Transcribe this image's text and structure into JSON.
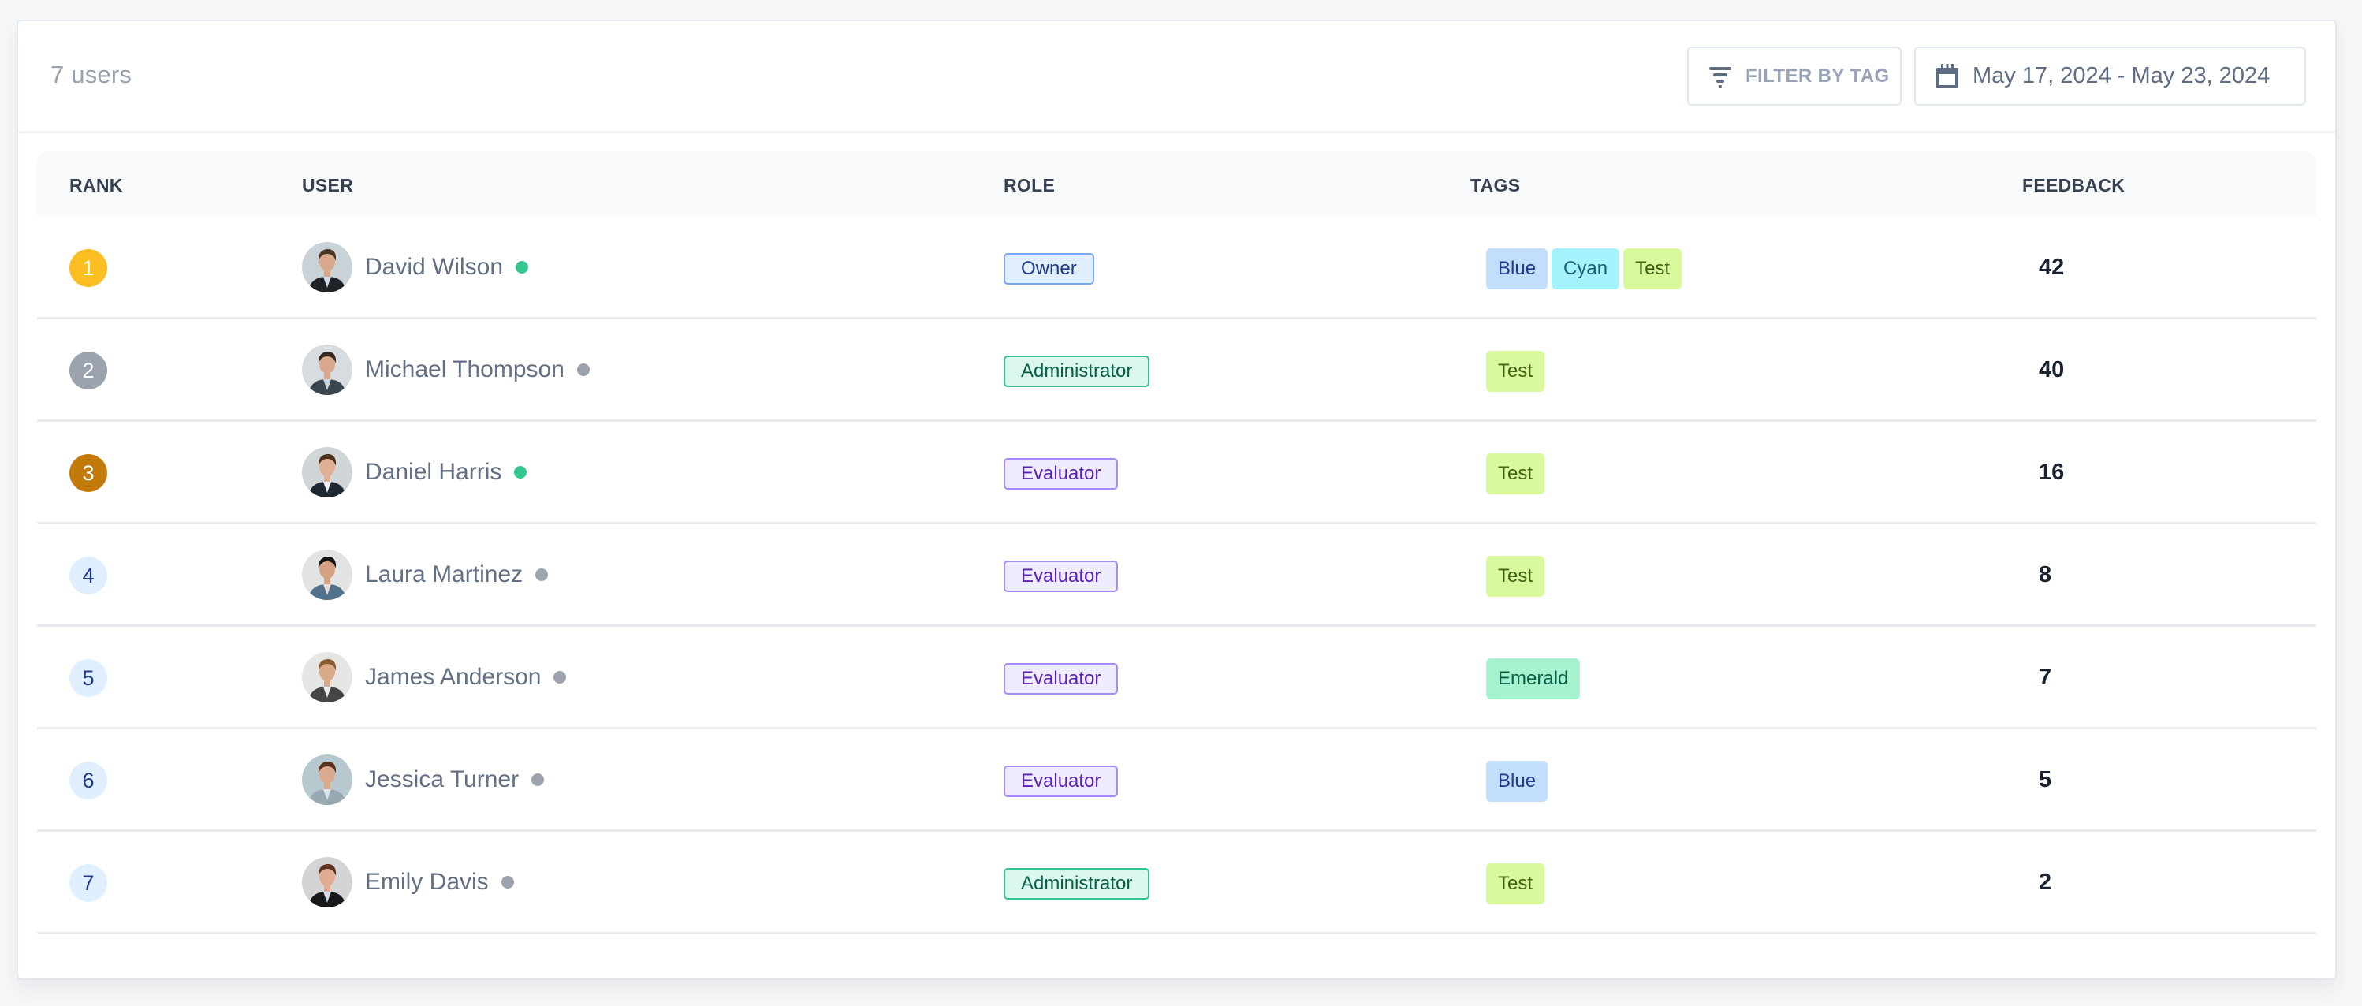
{
  "header": {
    "user_count": "7 users",
    "filter_button": {
      "label": "FILTER BY TAG",
      "icon": "filter-icon"
    },
    "date_range": {
      "label": "May 17, 2024 - May 23, 2024",
      "icon": "calendar-icon"
    }
  },
  "table": {
    "columns": [
      "RANK",
      "USER",
      "ROLE",
      "TAGS",
      "FEEDBACK"
    ],
    "rows": [
      {
        "rank": "1",
        "rank_style": "gold",
        "name": "David Wilson",
        "online": true,
        "role": "Owner",
        "tags": [
          "Blue",
          "Cyan",
          "Test"
        ],
        "feedback": "42"
      },
      {
        "rank": "2",
        "rank_style": "silver",
        "name": "Michael Thompson",
        "online": false,
        "role": "Administrator",
        "tags": [
          "Test"
        ],
        "feedback": "40"
      },
      {
        "rank": "3",
        "rank_style": "bronze",
        "name": "Daniel Harris",
        "online": true,
        "role": "Evaluator",
        "tags": [
          "Test"
        ],
        "feedback": "16"
      },
      {
        "rank": "4",
        "rank_style": "default",
        "name": "Laura Martinez",
        "online": false,
        "role": "Evaluator",
        "tags": [
          "Test"
        ],
        "feedback": "8"
      },
      {
        "rank": "5",
        "rank_style": "default",
        "name": "James Anderson",
        "online": false,
        "role": "Evaluator",
        "tags": [
          "Emerald"
        ],
        "feedback": "7"
      },
      {
        "rank": "6",
        "rank_style": "default",
        "name": "Jessica Turner",
        "online": false,
        "role": "Evaluator",
        "tags": [
          "Blue"
        ],
        "feedback": "5"
      },
      {
        "rank": "7",
        "rank_style": "default",
        "name": "Emily Davis",
        "online": false,
        "role": "Administrator",
        "tags": [
          "Test"
        ],
        "feedback": "2"
      }
    ]
  },
  "colors": {
    "rank": {
      "gold": {
        "bg": "#fbbf24",
        "fg": "#ffffff"
      },
      "silver": {
        "bg": "#9ca3af",
        "fg": "#ffffff"
      },
      "bronze": {
        "bg": "#c27b0b",
        "fg": "#ffffff"
      },
      "default": {
        "bg": "#e0efff",
        "fg": "#1e3a8a"
      }
    },
    "presence": {
      "online": "#34c78f",
      "offline": "#9ca3af"
    },
    "roles": {
      "Owner": {
        "bg": "#e1eefe",
        "border": "#74a8f5",
        "fg": "#1e3a8a"
      },
      "Administrator": {
        "bg": "#dcf7ee",
        "border": "#34c48f",
        "fg": "#065f46"
      },
      "Evaluator": {
        "bg": "#eeecfe",
        "border": "#a78bfa",
        "fg": "#5b21b6"
      }
    },
    "tags": {
      "Blue": {
        "bg": "#c3ddfd",
        "fg": "#1e3a8a"
      },
      "Cyan": {
        "bg": "#a5f3fc",
        "fg": "#155e75"
      },
      "Test": {
        "bg": "#d9f99d",
        "fg": "#3f6212"
      },
      "Emerald": {
        "bg": "#a7f3d0",
        "fg": "#065f46"
      }
    },
    "avatar_palettes": [
      {
        "bg": "#c9d2d6",
        "hair": "#4a3424",
        "skin": "#d9a88a",
        "suit": "#1f2328",
        "shirt": "#cfdbe6"
      },
      {
        "bg": "#d6dcdf",
        "hair": "#3a2a1e",
        "skin": "#d8a98c",
        "suit": "#3c4650",
        "shirt": "#c8d6e5"
      },
      {
        "bg": "#d0d5d8",
        "hair": "#4b3020",
        "skin": "#e0b094",
        "suit": "#1d2833",
        "shirt": "#f0f2f4"
      },
      {
        "bg": "#e2e4e4",
        "hair": "#151515",
        "skin": "#d4a283",
        "suit": "#52718a",
        "shirt": "#e8dfd2"
      },
      {
        "bg": "#e6e6e4",
        "hair": "#8a5a32",
        "skin": "#d9a98a",
        "suit": "#454545",
        "shirt": "#e8ecef"
      },
      {
        "bg": "#b8c8cf",
        "hair": "#5a3420",
        "skin": "#dba98e",
        "suit": "#98a9b3",
        "shirt": "#d8e4ec"
      },
      {
        "bg": "#d3d4d3",
        "hair": "#5b3220",
        "skin": "#e0ad92",
        "suit": "#17191c",
        "shirt": "#cfdbe6"
      }
    ]
  }
}
